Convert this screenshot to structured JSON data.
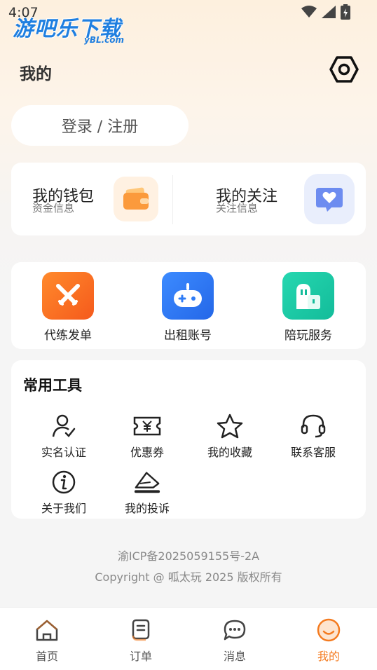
{
  "status_bar": {
    "time": "4:07"
  },
  "watermark": {
    "text": "游吧乐下载",
    "sub": "yBL.com"
  },
  "header": {
    "title": "我的"
  },
  "login": {
    "label": "登录 / 注册"
  },
  "wallet": {
    "left": {
      "title": "我的钱包",
      "subtitle": "资金信息",
      "icon": "wallet-icon"
    },
    "right": {
      "title": "我的关注",
      "subtitle": "关注信息",
      "icon": "heart-chat-icon"
    }
  },
  "services": [
    {
      "label": "代练发单",
      "icon": "crossed-swords-icon",
      "color": "#fb6d21"
    },
    {
      "label": "出租账号",
      "icon": "gamepad-icon",
      "color": "#2f7cf6"
    },
    {
      "label": "陪玩服务",
      "icon": "companion-icon",
      "color": "#19c9a6"
    }
  ],
  "tools": {
    "title": "常用工具",
    "items": [
      {
        "label": "实名认证",
        "icon": "user-check-icon"
      },
      {
        "label": "优惠券",
        "icon": "coupon-icon"
      },
      {
        "label": "我的收藏",
        "icon": "star-icon"
      },
      {
        "label": "联系客服",
        "icon": "headset-icon"
      },
      {
        "label": "关于我们",
        "icon": "info-icon"
      },
      {
        "label": "我的投诉",
        "icon": "complaint-icon"
      }
    ]
  },
  "footer": {
    "icp": "渝ICP备2025059155号-2A",
    "copyright": "Copyright @ 呱太玩 2025 版权所有"
  },
  "tabbar": {
    "items": [
      {
        "label": "首页",
        "icon": "home-icon"
      },
      {
        "label": "订单",
        "icon": "order-icon"
      },
      {
        "label": "消息",
        "icon": "message-icon"
      },
      {
        "label": "我的",
        "icon": "smile-icon"
      }
    ],
    "active_index": 3,
    "active_color": "#f47b20"
  }
}
